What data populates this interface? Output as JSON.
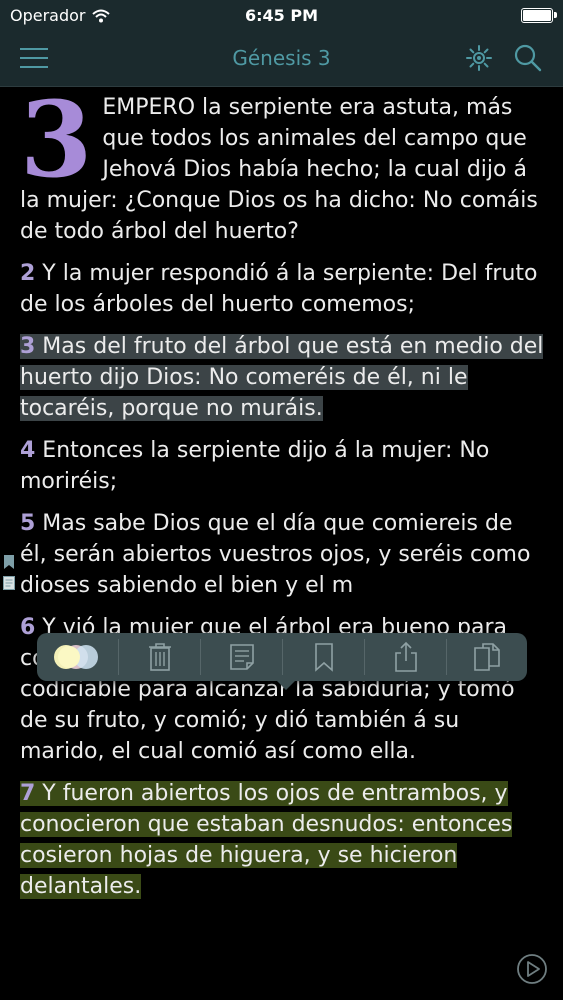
{
  "status_bar": {
    "carrier": "Operador",
    "time": "6:45 PM"
  },
  "nav": {
    "title": "Génesis 3"
  },
  "chapter": {
    "dropcap": "3",
    "verses": [
      {
        "number": "",
        "text": "EMPERO la serpiente era astuta, más que todos los animales del campo que Jehová Dios había hecho; la cual dijo á la mujer: ¿Conque Dios os ha dicho: No comáis de todo árbol del huerto?"
      },
      {
        "number": "2",
        "text": " Y la mujer respondió á la serpiente: Del fruto de los árboles del huerto comemos;"
      },
      {
        "number": "3",
        "text": " Mas del fruto del árbol que está en medio del huerto dijo Dios: No comeréis de él, ni le tocaréis, porque no muráis."
      },
      {
        "number": "4",
        "text": " Entonces la serpiente dijo á la mujer: No moriréis;"
      },
      {
        "number": "5",
        "text": " Mas sabe Dios que el día que comiereis de él, serán abiertos vuestros ojos, y seréis como dioses sabiendo el bien y el m"
      },
      {
        "number": "6",
        "text": " Y vió la mujer que el árbol era bueno para comer, y que era agradable á los ojos, y árbol codiciable para alcanzar la sabiduría; y tomó de su fruto, y comió; y dió también á su marido, el cual comió así como ella."
      },
      {
        "number": "7",
        "text": " Y fueron abiertos los ojos de entrambos, y conocieron que estaban desnudos: entonces cosieron hojas de higuera, y se hicieron delantales."
      }
    ]
  },
  "highlight_colors": {
    "grey": "#3c4447",
    "green": "#3a4a16"
  },
  "icons": [
    "menu-icon",
    "brightness-icon",
    "search-icon",
    "color-picker-icon",
    "trash-icon",
    "note-icon",
    "bookmark-icon",
    "share-icon",
    "copy-icon",
    "play-icon"
  ]
}
